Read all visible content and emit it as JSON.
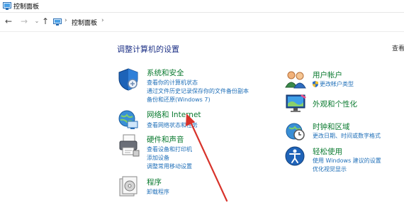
{
  "window": {
    "title": "控制面板"
  },
  "address": {
    "crumb": "控制面板",
    "sep": "›"
  },
  "nav": {
    "back": "←",
    "forward": "→",
    "dropdown": "⌄",
    "up": "↑"
  },
  "main": {
    "heading": "调整计算机的设置",
    "view_by": "查看方式"
  },
  "left": [
    {
      "title": "系统和安全",
      "links": [
        "查看你的计算机状态",
        "通过文件历史记录保存你的文件备份副本",
        "备份和还原(Windows 7)"
      ]
    },
    {
      "title": "网络和 Internet",
      "links": [
        "查看网络状态和任务"
      ]
    },
    {
      "title": "硬件和声音",
      "links": [
        "查看设备和打印机",
        "添加设备",
        "调整常用移动设置"
      ]
    },
    {
      "title": "程序",
      "links": [
        "卸载程序"
      ]
    }
  ],
  "right": [
    {
      "title": "用户帐户",
      "links": [
        "更改帐户类型"
      ]
    },
    {
      "title": "外观和个性化",
      "links": []
    },
    {
      "title": "时钟和区域",
      "links": [
        "更改日期、时间或数字格式"
      ]
    },
    {
      "title": "轻松使用",
      "links": [
        "使用 Windows 建议的设置",
        "优化视觉显示"
      ]
    }
  ],
  "colors": {
    "category": "#0a7a2f",
    "link": "#1f6fb8",
    "heading": "#1e3287",
    "arrow": "#d8332b"
  }
}
